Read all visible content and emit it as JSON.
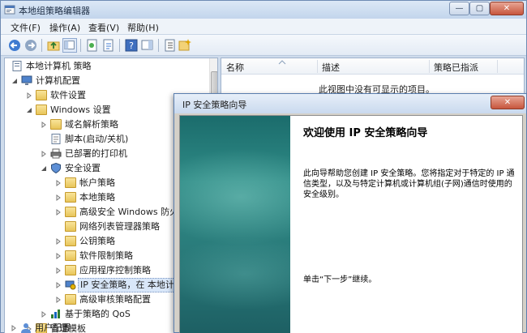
{
  "window": {
    "title": "本地组策略编辑器",
    "caption_min": "—",
    "caption_max": "▢",
    "caption_close": "✕"
  },
  "menu": {
    "file": "文件(F)",
    "action": "操作(A)",
    "view": "查看(V)",
    "help": "帮助(H)"
  },
  "tree": {
    "root": "本地计算机 策略",
    "computer_config": "计算机配置",
    "software_settings": "软件设置",
    "windows_settings": "Windows 设置",
    "name_resolution_policy": "域名解析策略",
    "scripts": "脚本(启动/关机)",
    "deployed_printers": "已部署的打印机",
    "security_settings": "安全设置",
    "account_policies": "帐户策略",
    "local_policies": "本地策略",
    "advanced_firewall": "高级安全 Windows 防火墙",
    "network_list_manager": "网络列表管理器策略",
    "public_key_policies": "公钥策略",
    "software_restriction": "软件限制策略",
    "app_control": "应用程序控制策略",
    "ip_security": "IP 安全策略，在 本地计算机",
    "advanced_audit": "高级审核策略配置",
    "policy_qos": "基于策略的 QoS",
    "admin_templates": "管理模板",
    "user_config": "用户配置"
  },
  "list": {
    "col_name": "名称",
    "col_desc": "描述",
    "col_assigned": "策略已指派",
    "empty_message": "此视图中没有可显示的项目。"
  },
  "wizard": {
    "title": "IP 安全策略向导",
    "close": "✕",
    "heading": "欢迎使用 IP 安全策略向导",
    "description": "此向导帮助您创建 IP 安全策略。您将指定对于特定的 IP 通信类型，以及与特定计算机或计算机组(子网)通信时使用的安全级别。",
    "next_hint": "单击“下一步”继续。"
  },
  "colors": {
    "accent": "#2f8b86",
    "selection": "#d9e7f9"
  }
}
